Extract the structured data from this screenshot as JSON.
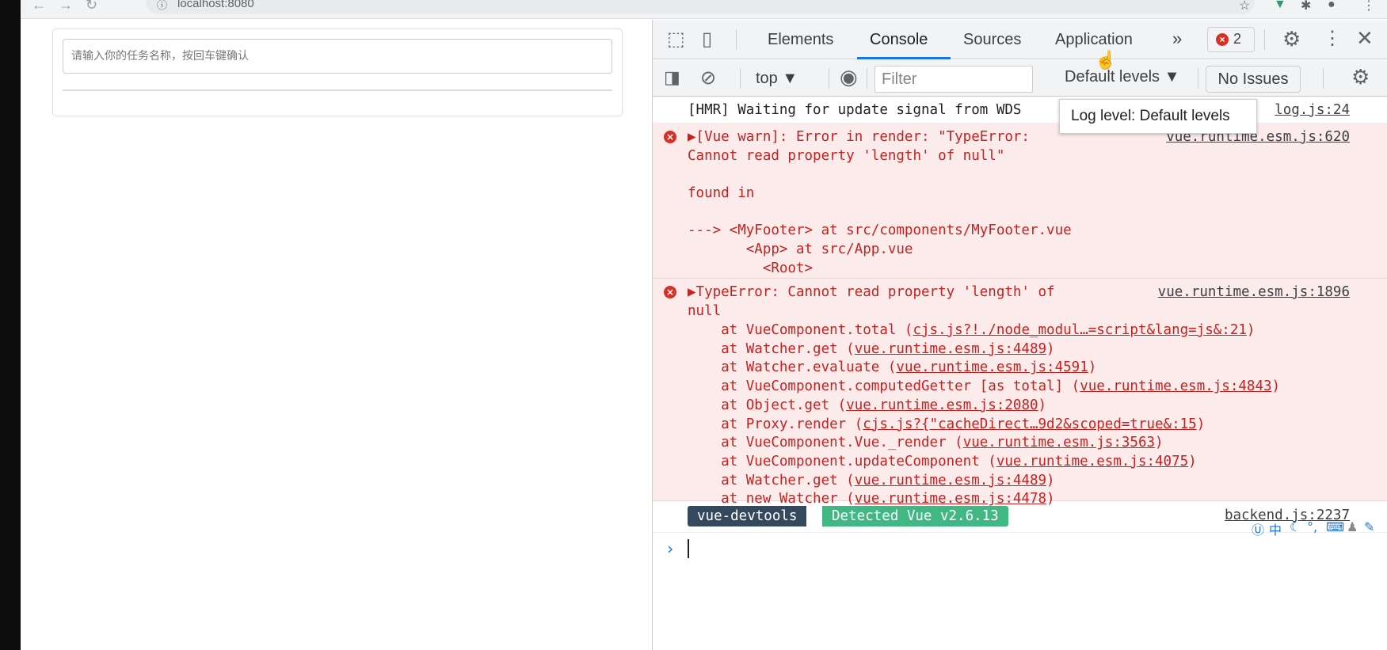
{
  "browser": {
    "url": "localhost:8080",
    "back_icon": "arrow-left-icon",
    "forward_icon": "arrow-right-icon",
    "reload_icon": "reload-icon",
    "info_icon": "info-icon"
  },
  "todo": {
    "placeholder": "请输入你的任务名称，按回车键确认",
    "value": ""
  },
  "devtools": {
    "tabs": [
      "Elements",
      "Console",
      "Sources",
      "Application"
    ],
    "active_tab": "Console",
    "more_tabs_label": "»",
    "error_count": "2",
    "toolbar": {
      "context": "top ▼",
      "filter_placeholder": "Filter",
      "levels": "Default levels ▼",
      "no_issues": "No Issues"
    },
    "tooltip": "Log level: Default levels",
    "messages": {
      "hmr": {
        "text": "[HMR] Waiting for update signal from WDS",
        "source": "log.js:24"
      },
      "vue_warn": {
        "lines": [
          "▶[Vue warn]: Error in render: \"TypeError:",
          "Cannot read property 'length' of null\"",
          "",
          "found in",
          "",
          "---> <MyFooter> at src/components/MyFooter.vue",
          "       <App> at src/App.vue",
          "         <Root>"
        ],
        "source": "vue.runtime.esm.js:620"
      },
      "type_error": {
        "header": [
          "▶TypeError: Cannot read property 'length' of",
          "null"
        ],
        "source": "vue.runtime.esm.js:1896",
        "stack": [
          {
            "prefix": "    at VueComponent.total (",
            "link": "cjs.js?!./node_modul…=script&lang=js&:21",
            "suffix": ")"
          },
          {
            "prefix": "    at Watcher.get (",
            "link": "vue.runtime.esm.js:4489",
            "suffix": ")"
          },
          {
            "prefix": "    at Watcher.evaluate (",
            "link": "vue.runtime.esm.js:4591",
            "suffix": ")"
          },
          {
            "prefix": "    at VueComponent.computedGetter [as total] (",
            "link": "vue.runtime.esm.js:4843",
            "suffix": ")"
          },
          {
            "prefix": "    at Object.get (",
            "link": "vue.runtime.esm.js:2080",
            "suffix": ")"
          },
          {
            "prefix": "    at Proxy.render (",
            "link": "cjs.js?{\"cacheDirect…9d2&scoped=true&:15",
            "suffix": ")"
          },
          {
            "prefix": "    at VueComponent.Vue._render (",
            "link": "vue.runtime.esm.js:3563",
            "suffix": ")"
          },
          {
            "prefix": "    at VueComponent.updateComponent (",
            "link": "vue.runtime.esm.js:4075",
            "suffix": ")"
          },
          {
            "prefix": "    at Watcher.get (",
            "link": "vue.runtime.esm.js:4489",
            "suffix": ")"
          },
          {
            "prefix": "    at new Watcher (",
            "link": "vue.runtime.esm.js:4478",
            "suffix": ")"
          }
        ]
      },
      "devtools_badge": {
        "left": "vue-devtools",
        "right": "Detected Vue v2.6.13",
        "source": "backend.js:2237"
      }
    },
    "prompt_symbol": "›"
  },
  "ime": {
    "chinese_mode": "中",
    "icons": [
      "ime-logo-icon",
      "moon-icon",
      "punctuation-icon",
      "keyboard-icon",
      "user-icon",
      "wrench-icon"
    ]
  },
  "colors": {
    "error_bg": "#fcebeb",
    "error_text": "#c5221f",
    "accent": "#1a73e8",
    "vue_green": "#41b883",
    "vue_dark": "#35495e"
  }
}
